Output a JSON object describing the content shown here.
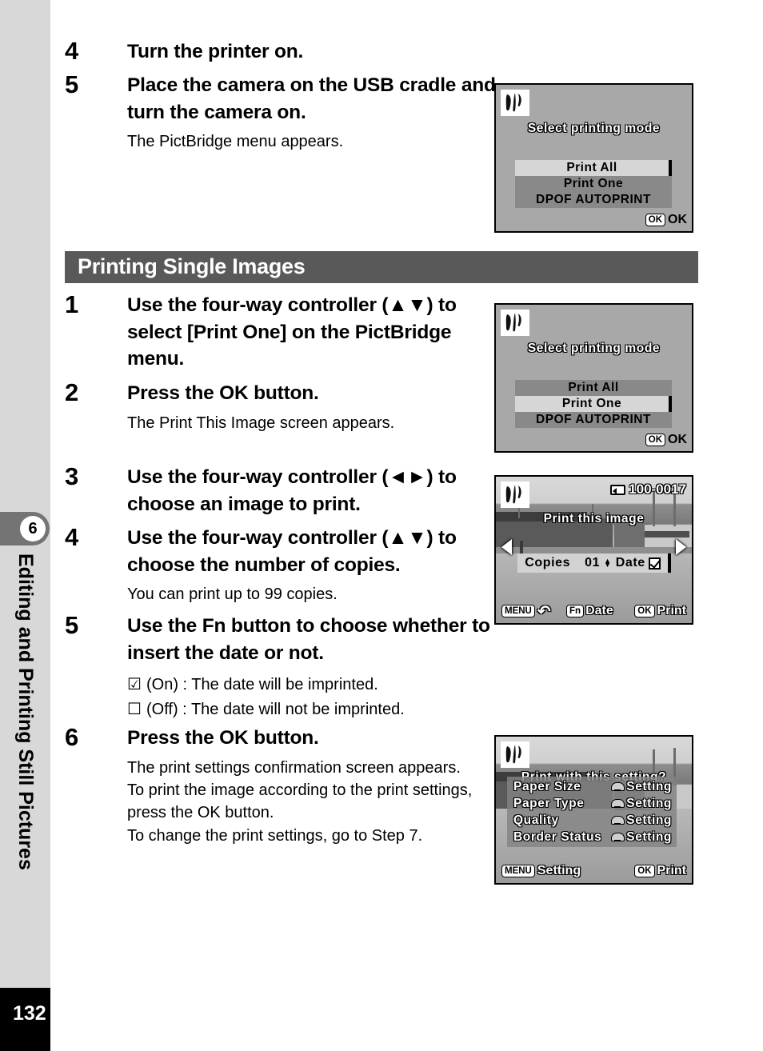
{
  "sidebar": {
    "chapter_number": "6",
    "chapter_title": "Editing and Printing Still Pictures",
    "page_number": "132"
  },
  "section": {
    "heading": "Printing Single Images"
  },
  "steps_before": [
    {
      "number": "4",
      "title": "Turn the printer on.",
      "desc": ""
    },
    {
      "number": "5",
      "title": "Place the camera on the USB cradle and turn the camera on.",
      "desc": "The PictBridge menu appears."
    }
  ],
  "steps": [
    {
      "number": "1",
      "title": "Use the four-way controller (▲▼) to select [Print One] on the PictBridge menu.",
      "desc": ""
    },
    {
      "number": "2",
      "title": "Press the OK button.",
      "desc": "The Print This Image screen appears."
    },
    {
      "number": "3",
      "title": "Use the four-way controller (◄►) to choose an image to print.",
      "desc": ""
    },
    {
      "number": "4",
      "title": "Use the four-way controller (▲▼) to choose the number of copies.",
      "desc": "You can print up to 99 copies."
    },
    {
      "number": "5",
      "title": "Use the Fn button to choose whether to insert the date or not.",
      "desc": "",
      "bullets": [
        {
          "mark": "☑",
          "text": "(On) : The date will be imprinted."
        },
        {
          "mark": "☐",
          "text": "(Off) : The date will not be imprinted."
        }
      ]
    },
    {
      "number": "6",
      "title": "Press the OK button.",
      "desc": "The print settings confirmation screen appears.\nTo print the image according to the print settings, press the OK button.\nTo change the print settings, go to Step 7."
    }
  ],
  "lcd_screens": [
    {
      "id": "select-printing-mode-print-all",
      "logo": "pictbridge-logo",
      "title": "Select printing mode",
      "menu_items": [
        "Print All",
        "Print One",
        "DPOF AUTOPRINT"
      ],
      "selected_index": 0,
      "ok_chip": "OK",
      "ok_label": "OK"
    },
    {
      "id": "select-printing-mode-print-one",
      "logo": "pictbridge-logo",
      "title": "Select printing mode",
      "menu_items": [
        "Print All",
        "Print One",
        "DPOF AUTOPRINT"
      ],
      "selected_index": 1,
      "ok_chip": "OK",
      "ok_label": "OK"
    },
    {
      "id": "print-this-image",
      "logo": "pictbridge-logo",
      "frame_number": "100-0017",
      "title": "Print this image",
      "copies_label": "Copies",
      "copies_value": "01",
      "date_label": "Date",
      "date_checked": true,
      "bottom": {
        "menu_chip": "MENU",
        "menu_label": "↶",
        "fn_chip": "Fn",
        "fn_label": "Date",
        "ok_chip": "OK",
        "ok_label": "Print"
      }
    },
    {
      "id": "print-with-this-setting",
      "logo": "pictbridge-logo",
      "title": "Print with this setting?",
      "settings_rows": [
        {
          "label": "Paper Size",
          "value": "Setting"
        },
        {
          "label": "Paper Type",
          "value": "Setting"
        },
        {
          "label": "Quality",
          "value": "Setting"
        },
        {
          "label": "Border Status",
          "value": "Setting"
        }
      ],
      "bottom": {
        "menu_chip": "MENU",
        "menu_label": "Setting",
        "ok_chip": "OK",
        "ok_label": "Print"
      }
    }
  ],
  "colors": {
    "sidebar_bg": "#d8d8d8",
    "chapter_tab_bg": "#747474",
    "section_bar_bg": "#595959",
    "lcd_bg": "#a8a8a8",
    "lcd_menu_bg": "#898989",
    "lcd_selected_bg": "#d6d6d6",
    "page_block_bg": "#000000"
  }
}
